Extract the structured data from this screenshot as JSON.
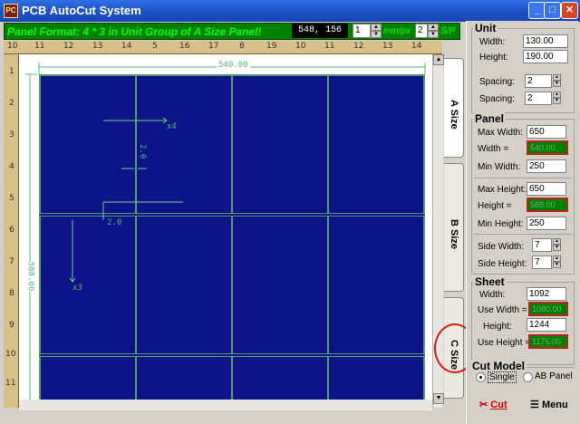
{
  "window": {
    "title": "PCB AutoCut System",
    "icon": "pcb-app-icon"
  },
  "toolbar": {
    "format_text": "Panel Format: 4 * 3 in Unit Group of A Size Panel!",
    "coords": "548, 156",
    "scale_value": "1",
    "scale_unit": "mm/px",
    "sp_value": "2",
    "sp_unit": "S/P"
  },
  "ruler": {
    "top_ticks": [
      "10",
      "11",
      "12",
      "13",
      "14",
      "5",
      "16",
      "17",
      "8",
      "19",
      "10",
      "11",
      "12",
      "13",
      "14"
    ],
    "left_ticks": [
      "1",
      "2",
      "3",
      "4",
      "5",
      "6",
      "7",
      "8",
      "9",
      "10",
      "11"
    ]
  },
  "drawing": {
    "width_dim": "540.00",
    "height_dim": "588.00",
    "x_spacing": "x4",
    "y_spacing": "x3",
    "gap_a": "2.0",
    "gap_b": "2.0"
  },
  "tabs": [
    "A Size",
    "B Size",
    "C Size"
  ],
  "unit": {
    "heading": "Unit",
    "width_label": "Width:",
    "width": "130.00",
    "height_label": "Height:",
    "height": "190.00",
    "spacing1_label": "Spacing:",
    "spacing1": "2",
    "spacing2_label": "Spacing:",
    "spacing2": "2"
  },
  "panel": {
    "heading": "Panel",
    "max_width_label": "Max Width:",
    "max_width": "650",
    "width_label": "Width  =",
    "width": "540.00",
    "min_width_label": "Min Width:",
    "min_width": "250",
    "max_height_label": "Max Height:",
    "max_height": "650",
    "height_label": "Height =",
    "height": "588.00",
    "min_height_label": "Min Height:",
    "min_height": "250",
    "side_width_label": "Side Width:",
    "side_width": "7",
    "side_height_label": "Side Height:",
    "side_height": "7"
  },
  "sheet": {
    "heading": "Sheet",
    "width_label": "Width:",
    "width": "1092",
    "use_width_label": "Use Width =",
    "use_width": "1080.00",
    "height_label": "Height:",
    "height": "1244",
    "use_height_label": "Use Height =",
    "use_height": "1176.00"
  },
  "cut_model": {
    "heading": "Cut Model",
    "single": "Single",
    "ab_panel": "AB Panel",
    "selected": "Single"
  },
  "buttons": {
    "cut": "Cut",
    "menu": "Menu"
  }
}
